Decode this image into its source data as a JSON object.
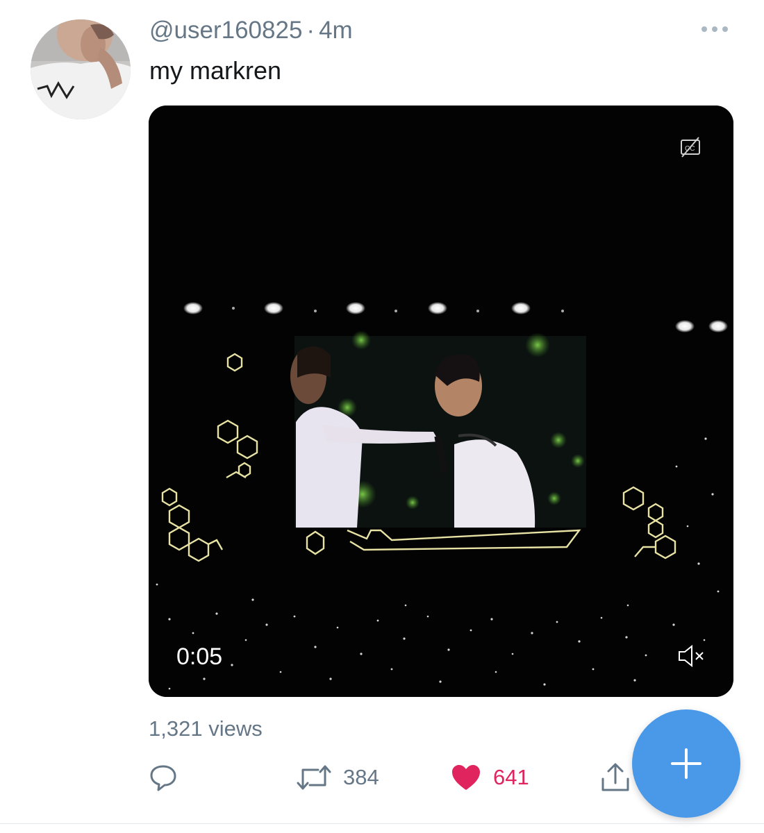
{
  "tweet": {
    "handle": "@user160825",
    "separator": "·",
    "time": "4m",
    "text": "my markren",
    "avatar_icon": "user-avatar",
    "more_icon": "ellipsis-icon",
    "views": "1,321 views"
  },
  "video": {
    "time": "0:05",
    "cc_icon": "closed-captions-off-icon",
    "mute_icon": "speaker-muted-icon",
    "accent_color": "#e8e3a4"
  },
  "actions": {
    "reply_icon": "reply-icon",
    "retweet_icon": "retweet-icon",
    "retweet_count": "384",
    "like_icon": "heart-filled-icon",
    "like_count": "641",
    "share_icon": "share-icon"
  },
  "compose": {
    "icon": "plus-icon",
    "color": "#4a99e9"
  },
  "colors": {
    "secondary_text": "#657786",
    "primary_text": "#14171a",
    "like": "#e0245e"
  }
}
